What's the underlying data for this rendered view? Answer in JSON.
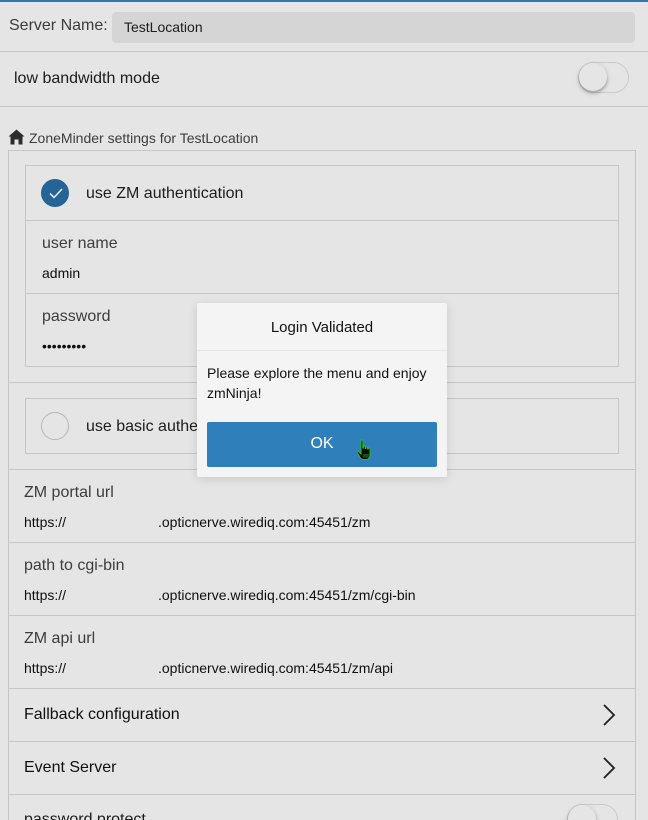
{
  "server": {
    "label": "Server Name:",
    "value": "TestLocation"
  },
  "low_bandwidth": {
    "label": "low bandwidth mode",
    "enabled": false
  },
  "zm_settings": {
    "header": "ZoneMinder settings for TestLocation",
    "use_zm_auth": {
      "label": "use ZM authentication",
      "checked": true
    },
    "username": {
      "label": "user name",
      "value": "admin"
    },
    "password": {
      "label": "password",
      "value": "•••••••••"
    },
    "use_basic_auth": {
      "label": "use basic authe",
      "checked": false
    },
    "portal_url": {
      "label": "ZM portal url",
      "prefix": "https://",
      "rest": ".opticnerve.wirediq.com:45451/zm"
    },
    "cgi_bin": {
      "label": "path to cgi-bin",
      "prefix": "https://",
      "rest": ".opticnerve.wirediq.com:45451/zm/cgi-bin"
    },
    "api_url": {
      "label": "ZM api url",
      "prefix": "https://",
      "rest": ".opticnerve.wirediq.com:45451/zm/api"
    },
    "fallback": {
      "label": "Fallback configuration"
    },
    "event_server": {
      "label": "Event Server"
    },
    "password_protect": {
      "label": "password protect",
      "enabled": false
    }
  },
  "dialog": {
    "title": "Login Validated",
    "message": "Please explore the menu and enjoy zmNinja!",
    "ok_label": "OK"
  },
  "colors": {
    "accent": "#2e7fba",
    "check": "#2a71a8"
  },
  "icons": [
    "home-icon",
    "checkmark-icon",
    "chevron-right-icon",
    "hand-cursor-icon"
  ]
}
